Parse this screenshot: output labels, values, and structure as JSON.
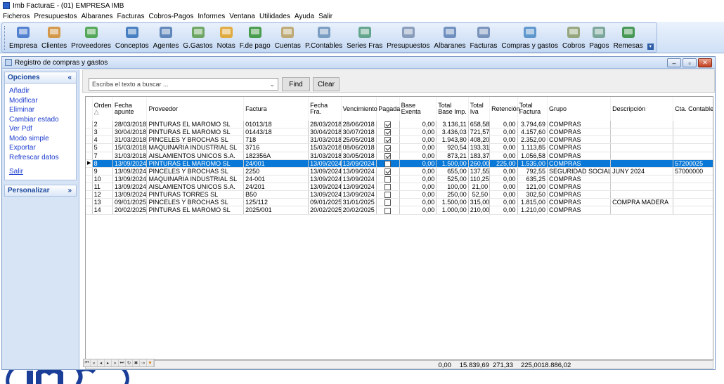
{
  "app": {
    "title": "Imb FacturaE - (01)  EMPRESA IMB"
  },
  "menu": [
    "Ficheros",
    "Presupuestos",
    "Albaranes",
    "Facturas",
    "Cobros-Pagos",
    "Informes",
    "Ventana",
    "Utilidades",
    "Ayuda",
    "Salir"
  ],
  "toolbar": [
    {
      "label": "Empresa",
      "icon": "computer-icon"
    },
    {
      "label": "Clientes",
      "icon": "clients-icon"
    },
    {
      "label": "Proveedores",
      "icon": "suppliers-icon"
    },
    {
      "label": "Conceptos",
      "icon": "concepts-icon"
    },
    {
      "label": "Agentes",
      "icon": "agents-icon"
    },
    {
      "label": "G.Gastos",
      "icon": "expenses-icon"
    },
    {
      "label": "Notas",
      "icon": "notes-icon"
    },
    {
      "label": "F.de pago",
      "icon": "euro-icon"
    },
    {
      "label": "Cuentas",
      "icon": "accounts-icon"
    },
    {
      "label": "P.Contables",
      "icon": "ledger-icon"
    },
    {
      "label": "Series Fras",
      "icon": "series-icon"
    },
    {
      "label": "Presupuestos",
      "icon": "budget-icon"
    },
    {
      "label": "Albaranes",
      "icon": "delivery-icon"
    },
    {
      "label": "Facturas",
      "icon": "invoice-icon"
    },
    {
      "label": "Compras y gastos",
      "icon": "purchases-icon"
    },
    {
      "label": "Cobros",
      "icon": "collections-icon"
    },
    {
      "label": "Pagos",
      "icon": "payments-icon"
    },
    {
      "label": "Remesas",
      "icon": "remittance-icon"
    }
  ],
  "window": {
    "title": "Registro de compras y gastos"
  },
  "sidebar": {
    "opciones_title": "Opciones",
    "items": [
      "Añadir",
      "Modificar",
      "Eliminar",
      "Cambiar estado",
      "Ver Pdf",
      "Modo simple",
      "Exportar",
      "Refrescar datos",
      "Salir"
    ],
    "personalizar_title": "Personalizar"
  },
  "search": {
    "placeholder": "Escriba el texto a buscar ...",
    "find_label": "Find",
    "clear_label": "Clear"
  },
  "table": {
    "headers": [
      "Orden",
      "Fecha apunte",
      "Proveedor",
      "Factura",
      "Fecha Fra.",
      "Vencimiento",
      "Pagada",
      "Base Exenta",
      "Total Base Imp.",
      "Total Iva",
      "Retención",
      "Total Factura",
      "Grupo",
      "Descripción",
      "Cta. Contable"
    ],
    "sort_indicator": "△",
    "rows": [
      {
        "orden": "2",
        "fecha": "28/03/2018",
        "proveedor": "PINTURAS EL MAROMO SL",
        "factura": "01013/18",
        "fechafra": "28/03/2018",
        "venc": "28/06/2018",
        "pagada": true,
        "exenta": "0,00",
        "base": "3.136,11",
        "iva": "658,58",
        "ret": "0,00",
        "total": "3.794,69",
        "grupo": "COMPRAS",
        "desc": "",
        "cta": ""
      },
      {
        "orden": "3",
        "fecha": "30/04/2018",
        "proveedor": "PINTURAS EL MAROMO SL",
        "factura": "01443/18",
        "fechafra": "30/04/2018",
        "venc": "30/07/2018",
        "pagada": true,
        "exenta": "0,00",
        "base": "3.436,03",
        "iva": "721,57",
        "ret": "0,00",
        "total": "4.157,60",
        "grupo": "COMPRAS",
        "desc": "",
        "cta": ""
      },
      {
        "orden": "4",
        "fecha": "31/03/2018",
        "proveedor": "PINCELES Y BROCHAS SL",
        "factura": "718",
        "fechafra": "31/03/2018",
        "venc": "25/05/2018",
        "pagada": true,
        "exenta": "0,00",
        "base": "1.943,80",
        "iva": "408,20",
        "ret": "0,00",
        "total": "2.352,00",
        "grupo": "COMPRAS",
        "desc": "",
        "cta": ""
      },
      {
        "orden": "5",
        "fecha": "15/03/2018",
        "proveedor": "MAQUINARIA INDUSTRIAL SL",
        "factura": "3716",
        "fechafra": "15/03/2018",
        "venc": "08/06/2018",
        "pagada": true,
        "exenta": "0,00",
        "base": "920,54",
        "iva": "193,31",
        "ret": "0,00",
        "total": "1.113,85",
        "grupo": "COMPRAS",
        "desc": "",
        "cta": ""
      },
      {
        "orden": "7",
        "fecha": "31/03/2018",
        "proveedor": "AISLAMIENTOS UNICOS S.A.",
        "factura": "182356A",
        "fechafra": "31/03/2018",
        "venc": "30/05/2018",
        "pagada": true,
        "exenta": "0,00",
        "base": "873,21",
        "iva": "183,37",
        "ret": "0,00",
        "total": "1.056,58",
        "grupo": "COMPRAS",
        "desc": "",
        "cta": ""
      },
      {
        "orden": "8",
        "fecha": "13/09/2024",
        "proveedor": "PINTURAS EL MAROMO SL",
        "factura": "24/001",
        "fechafra": "13/09/2024",
        "venc": "13/09/2024",
        "pagada": false,
        "exenta": "0,00",
        "base": "1.500,00",
        "iva": "260,00",
        "ret": "225,00",
        "total": "1.535,00",
        "grupo": "COMPRAS",
        "desc": "",
        "cta": "57200025",
        "selected": true
      },
      {
        "orden": "9",
        "fecha": "13/09/2024",
        "proveedor": "PINCELES Y BROCHAS SL",
        "factura": "2250",
        "fechafra": "13/09/2024",
        "venc": "13/09/2024",
        "pagada": true,
        "exenta": "0,00",
        "base": "655,00",
        "iva": "137,55",
        "ret": "0,00",
        "total": "792,55",
        "grupo": "SEGURIDAD SOCIAL",
        "desc": "JUNY 2024",
        "cta": "57000000"
      },
      {
        "orden": "10",
        "fecha": "13/09/2024",
        "proveedor": "MAQUINARIA INDUSTRIAL SL",
        "factura": "24-001",
        "fechafra": "13/09/2024",
        "venc": "13/09/2024",
        "pagada": false,
        "exenta": "0,00",
        "base": "525,00",
        "iva": "110,25",
        "ret": "0,00",
        "total": "635,25",
        "grupo": "COMPRAS",
        "desc": "",
        "cta": ""
      },
      {
        "orden": "11",
        "fecha": "13/09/2024",
        "proveedor": "AISLAMIENTOS UNICOS S.A.",
        "factura": "24/201",
        "fechafra": "13/09/2024",
        "venc": "13/09/2024",
        "pagada": false,
        "exenta": "0,00",
        "base": "100,00",
        "iva": "21,00",
        "ret": "0,00",
        "total": "121,00",
        "grupo": "COMPRAS",
        "desc": "",
        "cta": ""
      },
      {
        "orden": "12",
        "fecha": "13/09/2024",
        "proveedor": "PINTURAS TORRES SL",
        "factura": "B50",
        "fechafra": "13/09/2024",
        "venc": "13/09/2024",
        "pagada": false,
        "exenta": "0,00",
        "base": "250,00",
        "iva": "52,50",
        "ret": "0,00",
        "total": "302,50",
        "grupo": "COMPRAS",
        "desc": "",
        "cta": ""
      },
      {
        "orden": "13",
        "fecha": "09/01/2025",
        "proveedor": "PINCELES Y BROCHAS SL",
        "factura": "125/112",
        "fechafra": "09/01/2025",
        "venc": "31/01/2025",
        "pagada": false,
        "exenta": "0,00",
        "base": "1.500,00",
        "iva": "315,00",
        "ret": "0,00",
        "total": "1.815,00",
        "grupo": "COMPRAS",
        "desc": "COMPRA MADERA",
        "cta": ""
      },
      {
        "orden": "14",
        "fecha": "20/02/2025",
        "proveedor": "PINTURAS EL MAROMO SL",
        "factura": "2025/001",
        "fechafra": "20/02/2025",
        "venc": "20/02/2025",
        "pagada": false,
        "exenta": "0,00",
        "base": "1.000,00",
        "iva": "210,00",
        "ret": "0,00",
        "total": "1.210,00",
        "grupo": "COMPRAS",
        "desc": "",
        "cta": ""
      }
    ]
  },
  "totals": {
    "exenta": "0,00",
    "base": "15.839,69",
    "iva": "271,33",
    "ret": "225,00",
    "total": "18.886,02"
  },
  "navigator": [
    "first-icon",
    "prev-page-icon",
    "prev-icon",
    "next-icon",
    "next-page-icon",
    "last-icon",
    "refresh-icon",
    "bookmark-icon",
    "goto-bookmark-icon",
    "filter-icon"
  ],
  "colors": {
    "selection": "#0a78d7",
    "link": "#1c3cd0",
    "sidebar_head": "#1c4aa0"
  }
}
